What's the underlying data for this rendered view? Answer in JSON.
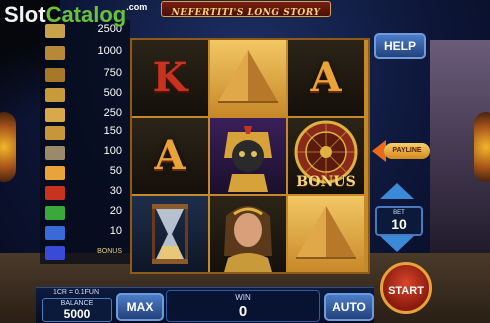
{
  "watermark": {
    "brand_a": "Slot",
    "brand_b": "Catalog",
    "suffix": ".com"
  },
  "game": {
    "title": "NEFERTITI'S LONG STORY"
  },
  "paytable": [
    {
      "symbol": "pharaoh-icon",
      "value": "2500",
      "color": "#c8a24a"
    },
    {
      "symbol": "queen-icon",
      "value": "1000",
      "color": "#b8883a"
    },
    {
      "symbol": "sphinx-icon",
      "value": "750",
      "color": "#a8782a"
    },
    {
      "symbol": "scarab-icon",
      "value": "500",
      "color": "#c89a3a"
    },
    {
      "symbol": "pyramid-icon",
      "value": "250",
      "color": "#d8a84a"
    },
    {
      "symbol": "ankh-icon",
      "value": "150",
      "color": "#c8963a"
    },
    {
      "symbol": "hourglass-icon",
      "value": "100",
      "color": "#9a8a6a"
    },
    {
      "symbol": "letter-a-icon",
      "value": "50",
      "color": "#e8a33a"
    },
    {
      "symbol": "letter-k-icon",
      "value": "30",
      "color": "#c8331f"
    },
    {
      "symbol": "letter-q-icon",
      "value": "20",
      "color": "#3aa83a"
    },
    {
      "symbol": "letter-j-icon",
      "value": "10",
      "color": "#3a6ad8"
    },
    {
      "symbol": "bonus-icon",
      "value": "BONUS",
      "color": "#3a4ad8"
    }
  ],
  "reels": [
    [
      "K",
      "A",
      "hourglass"
    ],
    [
      "pyramid",
      "pharaoh",
      "queen"
    ],
    [
      "A",
      "bonus",
      "pyramid"
    ]
  ],
  "reel_labels": {
    "bonus": "BONUS"
  },
  "buttons": {
    "help": "HELP",
    "payline": "PAYLINE",
    "max": "MAX",
    "auto": "AUTO",
    "start": "START"
  },
  "bet": {
    "label": "BET",
    "value": "10"
  },
  "balance": {
    "rate": "1CR = 0.1FUN",
    "label": "BALANCE",
    "value": "5000"
  },
  "win": {
    "label": "WIN",
    "value": "0"
  },
  "colors": {
    "frame": "#c48a2a",
    "button_blue": "#4b7cc8",
    "start_red": "#d8452a"
  }
}
